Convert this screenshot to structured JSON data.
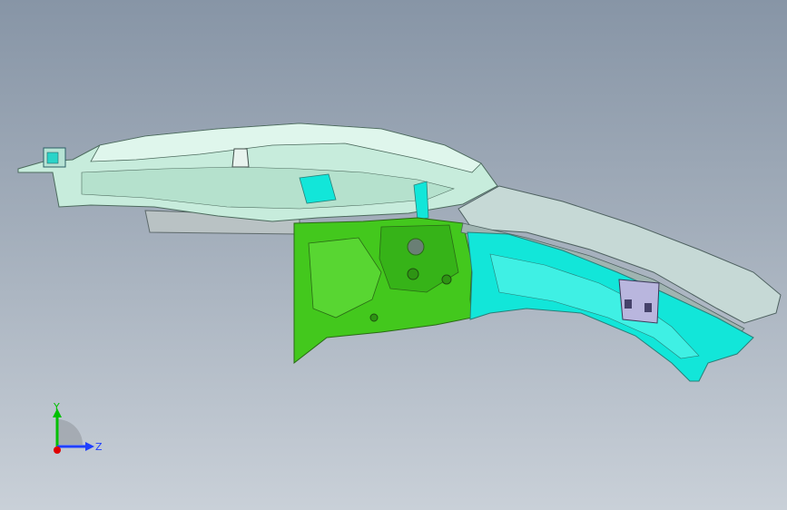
{
  "viewport": {
    "background_top": "#8795a6",
    "background_bottom": "#c9d0d8"
  },
  "model": {
    "colors": {
      "mint_part": "#c7ecdc",
      "mint_edge": "#4d6b5e",
      "green_part": "#43c81d",
      "cyan_part": "#12e6d9",
      "cyan_edge": "#2a7f79",
      "bracket": "#b9b6de",
      "grey_part": "#b9c2c4"
    }
  },
  "triad": {
    "y_label": "Y",
    "z_label": "Z",
    "y_color": "#00c000",
    "z_color": "#1f3fff",
    "x_color": "#e00000"
  }
}
